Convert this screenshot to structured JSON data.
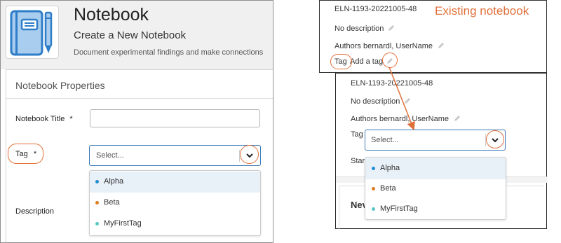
{
  "create_panel": {
    "title": "Notebook",
    "subtitle": "Create a New Notebook",
    "description": "Document experimental findings and make connections",
    "section_title": "Notebook Properties",
    "fields": {
      "title_label": "Notebook Title",
      "title_required": "*",
      "title_value": "",
      "tag_label": "Tag",
      "tag_required": "*",
      "description_label": "Description"
    },
    "tag_select": {
      "placeholder": "Select..."
    },
    "tag_options": [
      {
        "label": "Alpha",
        "color": "#1f8dd6",
        "highlighted": true
      },
      {
        "label": "Beta",
        "color": "#e07b1f",
        "highlighted": false
      },
      {
        "label": "MyFirstTag",
        "color": "#58c7c3",
        "highlighted": false
      }
    ]
  },
  "existing_panel": {
    "notebook_id": "ELN-1193-20221005-48",
    "caption": "Existing notebook",
    "description": "No description",
    "authors": "Authors bernardl, UserName",
    "tag_label": "Tag",
    "tag_add": "Add a tag"
  },
  "edit_panel": {
    "notebook_id": "ELN-1193-20221005-48",
    "description": "No description",
    "authors": "Authors bernardl, UserName",
    "tag_label": "Tag",
    "start_truncated": "Star",
    "new_truncated": "Nev",
    "tag_select": {
      "placeholder": "Select..."
    },
    "tag_options": [
      {
        "label": "Alpha",
        "color": "#1f8dd6",
        "highlighted": true
      },
      {
        "label": "Beta",
        "color": "#e07b1f",
        "highlighted": false
      },
      {
        "label": "MyFirstTag",
        "color": "#58c7c3",
        "highlighted": false
      }
    ]
  },
  "colors": {
    "annotation": "#e0703a",
    "select_border": "#3d7ab8",
    "highlight_bg": "#e8f0f8",
    "logo_blue": "#2d7dc8",
    "logo_light": "#a9cdee"
  },
  "icons": {
    "logo": "notebook-icon",
    "chevron": "chevron-down-icon",
    "edit": "pencil-icon"
  }
}
